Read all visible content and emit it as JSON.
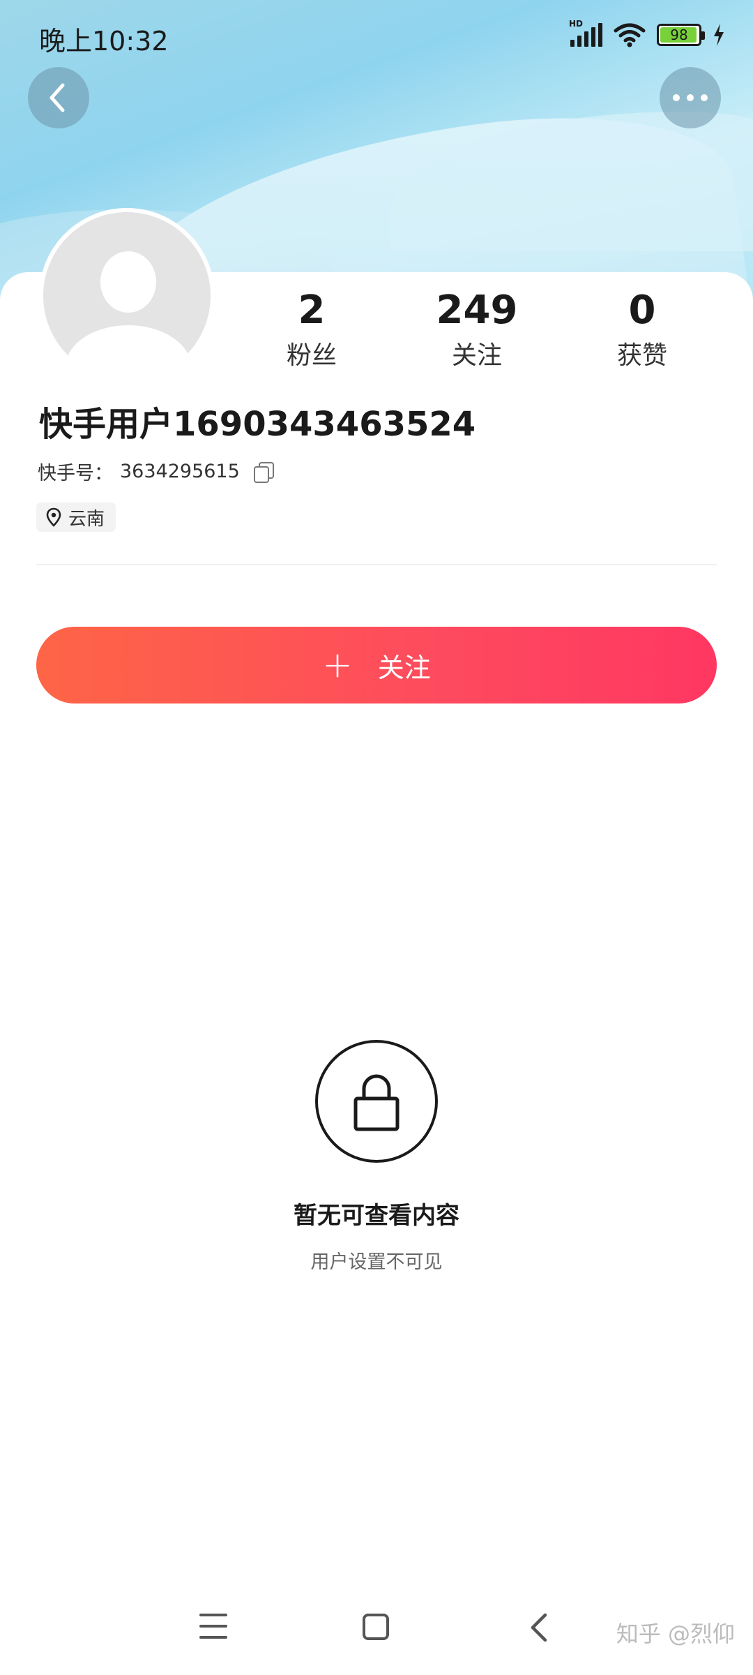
{
  "status_bar": {
    "time": "晚上10:32",
    "network": "HD",
    "battery": "98"
  },
  "header": {
    "back_icon": "chevron-left-icon",
    "more_icon": "more-dots-icon"
  },
  "profile": {
    "stats": [
      {
        "value": "2",
        "label": "粉丝"
      },
      {
        "value": "249",
        "label": "关注"
      },
      {
        "value": "0",
        "label": "获赞"
      }
    ],
    "username": "快手用户1690343463524",
    "id_label": "快手号：",
    "id_value": "3634295615",
    "location": "云南"
  },
  "follow_button": {
    "icon": "+",
    "label": "关注",
    "colors": [
      "#fe6546",
      "#ff3762"
    ]
  },
  "empty_state": {
    "title": "暂无可查看内容",
    "subtitle": "用户设置不可见",
    "icon": "lock-icon"
  },
  "watermark": "知乎 @烈仰"
}
